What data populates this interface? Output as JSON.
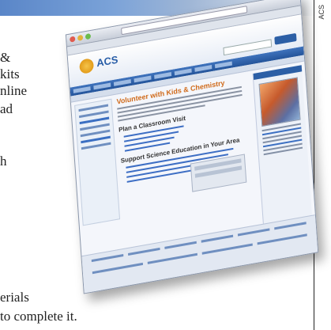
{
  "credit": "ACS",
  "article_lines": [
    "&",
    "kits",
    "nline",
    "ad",
    "h",
    "erials",
    "to complete it."
  ],
  "screenshot": {
    "org_name": "ACS",
    "page_heading": "Volunteer with Kids & Chemistry",
    "section1": "Plan a Classroom Visit",
    "section2": "Support Science Education in Your Area"
  },
  "colors": {
    "accent_blue": "#2c5fa6",
    "heading_orange": "#d06a1a",
    "logo_gold": "#e39c1b"
  }
}
